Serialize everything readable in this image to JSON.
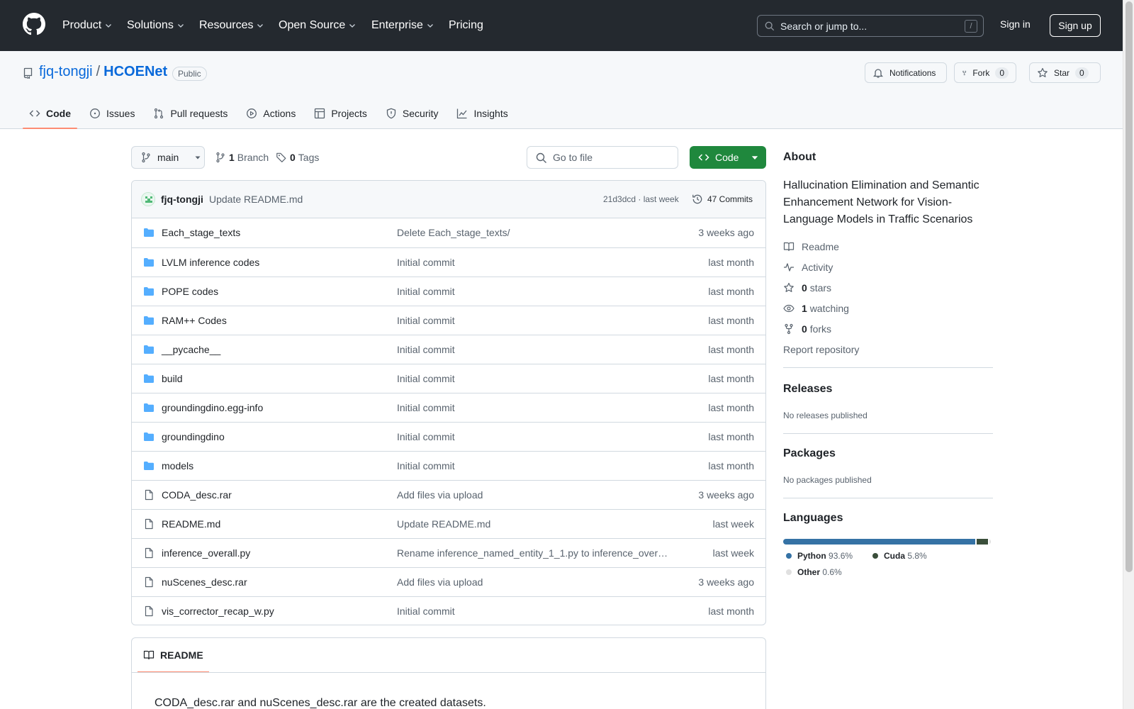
{
  "header": {
    "nav": [
      {
        "label": "Product",
        "dropdown": true
      },
      {
        "label": "Solutions",
        "dropdown": true
      },
      {
        "label": "Resources",
        "dropdown": true
      },
      {
        "label": "Open Source",
        "dropdown": true
      },
      {
        "label": "Enterprise",
        "dropdown": true
      },
      {
        "label": "Pricing",
        "dropdown": false
      }
    ],
    "search_placeholder": "Search or jump to...",
    "search_shortcut": "/",
    "sign_in": "Sign in",
    "sign_up": "Sign up"
  },
  "repo": {
    "owner": "fjq-tongji",
    "separator": "/",
    "name": "HCOENet",
    "visibility": "Public",
    "notifications_label": "Notifications",
    "fork_label": "Fork",
    "fork_count": "0",
    "star_label": "Star",
    "star_count": "0"
  },
  "tabs": [
    {
      "label": "Code",
      "icon": "code-icon",
      "active": true
    },
    {
      "label": "Issues",
      "icon": "issue-icon",
      "active": false
    },
    {
      "label": "Pull requests",
      "icon": "pull-request-icon",
      "active": false
    },
    {
      "label": "Actions",
      "icon": "play-icon",
      "active": false
    },
    {
      "label": "Projects",
      "icon": "table-icon",
      "active": false
    },
    {
      "label": "Security",
      "icon": "shield-icon",
      "active": false
    },
    {
      "label": "Insights",
      "icon": "graph-icon",
      "active": false
    }
  ],
  "toolbar": {
    "branch": "main",
    "branch_count": "1",
    "branch_label": "Branch",
    "tag_count": "0",
    "tag_label": "Tags",
    "goto_file": "Go to file",
    "code_button": "Code"
  },
  "commit": {
    "author": "fjq-tongji",
    "message": "Update README.md",
    "meta": "21d3dcd · last week",
    "commits_label": "47 Commits"
  },
  "files": [
    {
      "type": "folder",
      "name": "Each_stage_texts",
      "message": "Delete Each_stage_texts/",
      "date": "3 weeks ago"
    },
    {
      "type": "folder",
      "name": "LVLM inference codes",
      "message": "Initial commit",
      "date": "last month"
    },
    {
      "type": "folder",
      "name": "POPE codes",
      "message": "Initial commit",
      "date": "last month"
    },
    {
      "type": "folder",
      "name": "RAM++ Codes",
      "message": "Initial commit",
      "date": "last month"
    },
    {
      "type": "folder",
      "name": "__pycache__",
      "message": "Initial commit",
      "date": "last month"
    },
    {
      "type": "folder",
      "name": "build",
      "message": "Initial commit",
      "date": "last month"
    },
    {
      "type": "folder",
      "name": "groundingdino.egg-info",
      "message": "Initial commit",
      "date": "last month"
    },
    {
      "type": "folder",
      "name": "groundingdino",
      "message": "Initial commit",
      "date": "last month"
    },
    {
      "type": "folder",
      "name": "models",
      "message": "Initial commit",
      "date": "last month"
    },
    {
      "type": "file",
      "name": "CODA_desc.rar",
      "message": "Add files via upload",
      "date": "3 weeks ago"
    },
    {
      "type": "file",
      "name": "README.md",
      "message": "Update README.md",
      "date": "last week"
    },
    {
      "type": "file",
      "name": "inference_overall.py",
      "message": "Rename inference_named_entity_1_1.py to inference_over…",
      "date": "last week"
    },
    {
      "type": "file",
      "name": "nuScenes_desc.rar",
      "message": "Add files via upload",
      "date": "3 weeks ago"
    },
    {
      "type": "file",
      "name": "vis_corrector_recap_w.py",
      "message": "Initial commit",
      "date": "last month"
    }
  ],
  "readme": {
    "tab_label": "README",
    "first_line": "CODA_desc.rar and nuScenes_desc.rar are the created datasets."
  },
  "sidebar": {
    "about_title": "About",
    "description": "Hallucination Elimination and Semantic Enhancement Network for Vision-Language Models in Traffic Scenarios",
    "readme": "Readme",
    "activity": "Activity",
    "stars_count": "0",
    "stars_label": "stars",
    "watching_count": "1",
    "watching_label": "watching",
    "forks_count": "0",
    "forks_label": "forks",
    "report": "Report repository",
    "releases_title": "Releases",
    "releases_text": "No releases published",
    "packages_title": "Packages",
    "packages_text": "No packages published",
    "languages_title": "Languages",
    "languages": [
      {
        "name": "Python",
        "percent": "93.6%",
        "value": 93.6,
        "color": "#3572A5"
      },
      {
        "name": "Cuda",
        "percent": "5.8%",
        "value": 5.8,
        "color": "#3A4E3A"
      },
      {
        "name": "Other",
        "percent": "0.6%",
        "value": 0.6,
        "color": "#e0e0e0"
      }
    ]
  },
  "colors": {
    "header_bg": "#24292f",
    "link": "#0969da",
    "primary_button": "#1f883d",
    "active_tab_underline": "#fd8c73",
    "folder_icon": "#54aeff"
  }
}
